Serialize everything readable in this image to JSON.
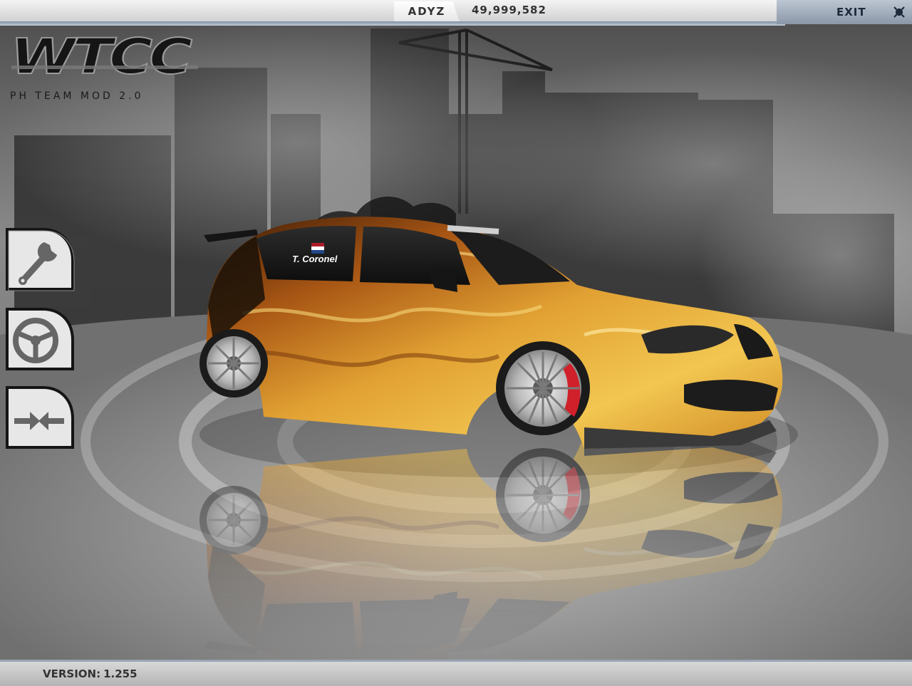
{
  "top_bar": {
    "player_name": "ADYZ",
    "money": "49,999,582",
    "exit_label": "EXIT"
  },
  "logo": {
    "title": "WTCC",
    "subtitle": "PH TEAM MOD 2.0"
  },
  "car": {
    "driver_name": "T. Coronel",
    "driver_flag": "netherlands-flag"
  },
  "side_menu": [
    {
      "name": "wrench-icon",
      "action": "tune"
    },
    {
      "name": "steering-wheel-icon",
      "action": "drive"
    },
    {
      "name": "compare-arrows-icon",
      "action": "compare"
    }
  ],
  "footer": {
    "version_label": "VERSION:",
    "version_value": "1.255"
  },
  "colors": {
    "top_bar": "#dcdcdc",
    "exit_panel": "#9aa6b6",
    "car_flame": "#e2a233",
    "backdrop": "#6c6c6c"
  }
}
